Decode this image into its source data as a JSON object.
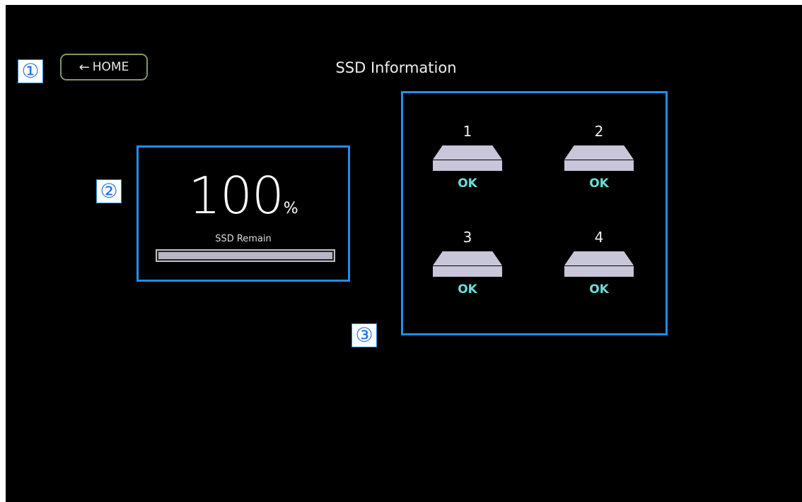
{
  "header": {
    "title": "SSD Information",
    "home_label": "HOME",
    "home_icon": "arrow-left-icon"
  },
  "callouts": [
    "①",
    "②",
    "③"
  ],
  "ssd_remain": {
    "value": "100",
    "unit": "%",
    "label": "SSD Remain",
    "progress_fraction": 1.0
  },
  "slots": [
    {
      "number": "1",
      "status": "OK"
    },
    {
      "number": "2",
      "status": "OK"
    },
    {
      "number": "3",
      "status": "OK"
    },
    {
      "number": "4",
      "status": "OK"
    }
  ],
  "colors": {
    "highlight_border": "#1d8ff0",
    "status_ok": "#68e0d8",
    "home_border": "#7f9960"
  }
}
